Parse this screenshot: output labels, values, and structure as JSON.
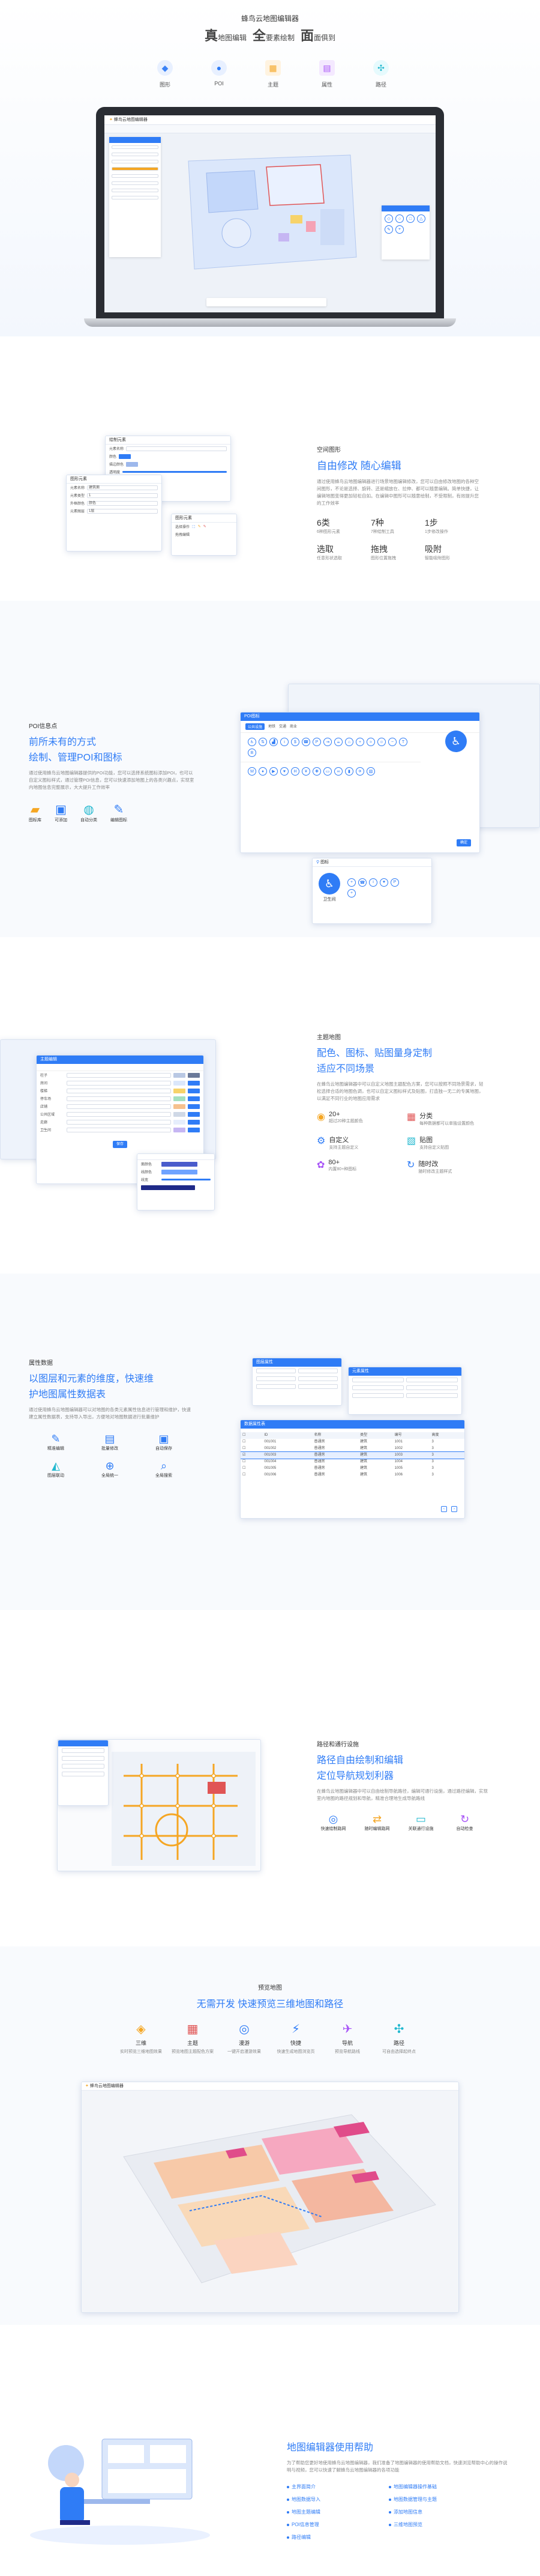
{
  "hero": {
    "app_name": "蜂鸟云地图编辑器",
    "slogan": [
      {
        "big": "真",
        "small": "地图编辑"
      },
      {
        "big": "全",
        "small": "要素绘制"
      },
      {
        "big": "面",
        "small": "面俱到"
      }
    ],
    "features": [
      {
        "label": "图形",
        "icon": "shapes-icon",
        "color": "#3b82f6"
      },
      {
        "label": "POI",
        "icon": "poi-icon",
        "color": "#2f7cf6"
      },
      {
        "label": "主题",
        "icon": "theme-icon",
        "color": "#f5a623"
      },
      {
        "label": "属性",
        "icon": "attribute-icon",
        "color": "#a855f7"
      },
      {
        "label": "路径",
        "icon": "path-icon",
        "color": "#22b8cf"
      }
    ],
    "laptop_window_title": "蜂鸟云地图编辑器"
  },
  "shape": {
    "section_label": "空间图形",
    "title": "自由修改 随心编辑",
    "desc": "通过使用蜂鸟云地图编辑器进行场景地图编辑修改，您可以自由修改地图的各种空间图形，不论是选择、旋转、还是缩放在、拉伸、都可以随意编辑。简单快捷，让编辑地图变得更加轻松自如。在编辑中图形可以随意绘制，不受限制，有效提升您的工作效率",
    "stats": [
      {
        "value": "6类",
        "note": "6种图形元素"
      },
      {
        "value": "7种",
        "note": "7种绘制工具"
      },
      {
        "value": "1步",
        "note": "1步修改操作"
      },
      {
        "value": "选取",
        "note": "任意形状选取"
      },
      {
        "value": "拖拽",
        "note": "图形位置拖拽"
      },
      {
        "value": "吸附",
        "note": "智能吸附图形"
      }
    ],
    "panel1_title": "绘制元素",
    "panel1_rows": [
      "元素名称",
      "颜色",
      "描边颜色",
      "透明度"
    ],
    "panel2_title": "图形元素",
    "panel2_rows": [
      "元素名称",
      "元素类型",
      "外框颜色",
      "元素图层"
    ],
    "panel2_values": [
      "建筑面",
      "1",
      "颜色",
      "1层"
    ],
    "panel3_title": "图形元素",
    "panel3_rows": [
      "选择操作",
      "拖拽编辑"
    ]
  },
  "poi": {
    "section_label": "POI信息点",
    "title_line1": "前所未有的方式",
    "title_line2": "绘制、管理POI和图标",
    "desc": "通过使用蜂鸟云地图编辑器提供的POI功能，您可以选择系统图标添加POI，也可以自定义图标样式，通过管理POI信息，您可以快速添加地图上的各类兴趣点，实现室内地图信息完整展示，大大提升工作效率",
    "features": [
      {
        "label": "图标库",
        "icon": "folder-icon"
      },
      {
        "label": "可添加",
        "icon": "add-image-icon"
      },
      {
        "label": "自动分类",
        "icon": "category-icon"
      },
      {
        "label": "编辑图标",
        "icon": "edit-icon"
      }
    ],
    "dialog_title": "POI图标",
    "dialog_tabs": [
      "公共设施",
      "地铁",
      "交通",
      "商业"
    ],
    "dialog_ok": "确定",
    "poi_card_label": "图标",
    "poi_card_name": "卫生间"
  },
  "theme": {
    "section_label": "主题地图",
    "title_line1": "配色、图标、贴图量身定制",
    "title_line2": "适应不同场景",
    "desc": "在蜂鸟云地图编辑器中可以自定义地图主题配色方案，您可以按照不同场景需求，轻松选择合适的地图色调，也可以自定义图标样式及贴图，打造独一无二的专属地图，以满足不同行业的地图应用需求",
    "items": [
      {
        "value": "20+",
        "text": "超过20种主题颜色",
        "icon": "palette-icon"
      },
      {
        "value": "分类",
        "text": "每种数据都可以单独设置颜色",
        "icon": "classify-icon"
      },
      {
        "value": "自定义",
        "text": "支持主题自定义",
        "icon": "custom-icon"
      },
      {
        "value": "贴图",
        "text": "支持自定义贴图",
        "icon": "texture-icon"
      },
      {
        "value": "80+",
        "text": "内置80+种图标",
        "icon": "icon-lib-icon"
      },
      {
        "value": "随时改",
        "text": "随时修改主题样式",
        "icon": "refresh-icon"
      }
    ],
    "win_title": "主题编辑",
    "rows": [
      "柱子",
      "房间",
      "楼梯",
      "停车场",
      "店铺",
      "公共区域",
      "走廊",
      "卫生间"
    ],
    "save": "保存",
    "side_rows": [
      "面颜色",
      "线颜色",
      "线宽"
    ]
  },
  "attr": {
    "section_label": "属性数据",
    "title_line1": "以图层和元素的维度，快速维",
    "title_line2": "护地图属性数据表",
    "desc": "通过使用蜂鸟云地图编辑器可以对地图的各类元素属性信息进行管理和维护，快速建立属性数据表，支持导入导出，方便地对地图数据进行批量维护",
    "features": [
      {
        "label": "精准编辑",
        "icon": "precise-edit-icon"
      },
      {
        "label": "批量修改",
        "icon": "batch-edit-icon"
      },
      {
        "label": "自动保存",
        "icon": "auto-save-icon"
      },
      {
        "label": "图层联动",
        "icon": "layer-link-icon"
      },
      {
        "label": "全局统一",
        "icon": "global-icon"
      },
      {
        "label": "全局搜索",
        "icon": "search-icon"
      }
    ],
    "table_title": "数据属性表",
    "table_cols": [
      "ID",
      "名称",
      "类型",
      "编号",
      "高度"
    ],
    "table_rows": [
      [
        "001001",
        "普通房",
        "建筑",
        "1001",
        "3"
      ],
      [
        "001002",
        "普通房",
        "建筑",
        "1002",
        "3"
      ],
      [
        "001003",
        "普通房",
        "建筑",
        "1003",
        "3"
      ],
      [
        "001004",
        "普通房",
        "建筑",
        "1004",
        "3"
      ],
      [
        "001005",
        "普通房",
        "建筑",
        "1005",
        "3"
      ],
      [
        "001006",
        "普通房",
        "建筑",
        "1006",
        "3"
      ]
    ],
    "panel_title": "图层属性",
    "panel2_title": "元素属性"
  },
  "route": {
    "section_label": "路径和通行设施",
    "title_line1": "路径自由绘制和编辑",
    "title_line2": "定位导航规划利器",
    "desc": "在蜂鸟云地图编辑器中可以自由绘制导航路径，编辑可通行设施，通过路径编辑，实现室内地图的路径规划和导航，精准合理地生成导航路线",
    "features": [
      {
        "label": "快速绘制路网",
        "icon": "route-draw-icon"
      },
      {
        "label": "随时编辑路网",
        "icon": "route-edit-icon"
      },
      {
        "label": "关联通行设施",
        "icon": "facility-icon"
      },
      {
        "label": "自动检查",
        "icon": "check-icon"
      }
    ]
  },
  "preview": {
    "section_label": "预览地图",
    "title": "无需开发 快速预览三维地图和路径",
    "features": [
      {
        "label": "三维",
        "note": "实时预览三维地图效果",
        "icon": "cube-icon"
      },
      {
        "label": "主题",
        "note": "预览地图主题配色方案",
        "icon": "theme-icon"
      },
      {
        "label": "漫游",
        "note": "一键开启漫游效果",
        "icon": "roam-icon"
      },
      {
        "label": "快捷",
        "note": "快速生成地图浏览页",
        "icon": "fast-icon"
      },
      {
        "label": "导航",
        "note": "预览导航路线",
        "icon": "nav-icon"
      },
      {
        "label": "路径",
        "note": "可自由选择起终点",
        "icon": "path-icon"
      }
    ],
    "window_title": "蜂鸟云地图编辑器"
  },
  "help": {
    "title": "地图编辑器使用帮助",
    "desc": "为了帮助您更好地使用蜂鸟云地图编辑器，我们准备了地图编辑器的使用帮助文档，快速浏览帮助中心的操作说明与视频，您可以快速了解蜂鸟云地图编辑器的各项功能",
    "links": [
      "主界面简介",
      "地图编辑器操作基础",
      "地图数据导入",
      "地图数据管理与主题",
      "地图主题编辑",
      "添加地图信息",
      "POI信息管理",
      "三维地图预览",
      "路径编辑"
    ]
  }
}
